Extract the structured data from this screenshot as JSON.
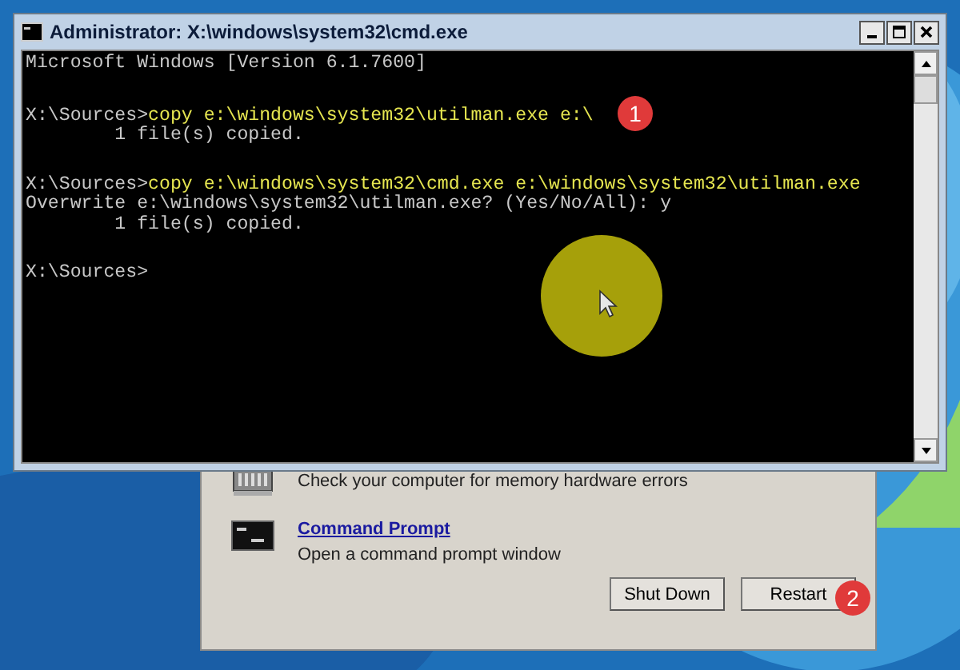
{
  "console_window": {
    "title": "Administrator: X:\\windows\\system32\\cmd.exe",
    "lines": [
      {
        "kind": "output",
        "text": "Microsoft Windows [Version 6.1.7600]",
        "new_block": false
      },
      {
        "kind": "command",
        "prompt": "X:\\Sources>",
        "command": "copy e:\\windows\\system32\\utilman.exe e:\\",
        "new_block": true
      },
      {
        "kind": "output",
        "text": "        1 file(s) copied.",
        "new_block": false
      },
      {
        "kind": "command",
        "prompt": "X:\\Sources>",
        "command": "copy e:\\windows\\system32\\cmd.exe e:\\windows\\system32\\utilman.exe",
        "new_block": true
      },
      {
        "kind": "output",
        "text": "Overwrite e:\\windows\\system32\\utilman.exe? (Yes/No/All): y",
        "new_block": false
      },
      {
        "kind": "output",
        "text": "        1 file(s) copied.",
        "new_block": false
      },
      {
        "kind": "command",
        "prompt": "X:\\Sources>",
        "new_block": true
      }
    ]
  },
  "recovery_dialog": {
    "tools": [
      {
        "kind": "memory",
        "description": "Check your computer for memory hardware errors"
      },
      {
        "kind": "cmd",
        "link": "Command Prompt",
        "description": "Open a command prompt window"
      }
    ],
    "buttons": [
      "Shut Down",
      "Restart"
    ]
  },
  "step_badges": [
    "1",
    "2"
  ]
}
